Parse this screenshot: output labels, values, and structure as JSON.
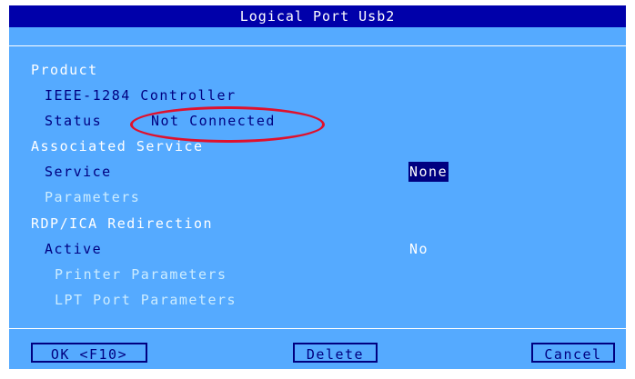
{
  "window": {
    "title": "Logical Port Usb2"
  },
  "product": {
    "section_label": "Product",
    "device_name": "IEEE-1284 Controller",
    "status_label": "Status",
    "status_value": "Not Connected"
  },
  "associated_service": {
    "section_label": "Associated Service",
    "service_label": "Service",
    "service_value": "None",
    "parameters_label": "Parameters"
  },
  "redirection": {
    "section_label": "RDP/ICA Redirection",
    "active_label": "Active",
    "active_value": "No",
    "printer_parameters_label": "Printer Parameters",
    "lpt_port_parameters_label": "LPT Port Parameters"
  },
  "buttons": {
    "ok_label": "OK <F10>",
    "delete_label": "Delete",
    "cancel_label": "Cancel"
  },
  "colors": {
    "dialog_background": "#55aaff",
    "titlebar_background": "#0000aa",
    "selected_value_background": "#000080",
    "annotation_ellipse": "#e0102c"
  }
}
